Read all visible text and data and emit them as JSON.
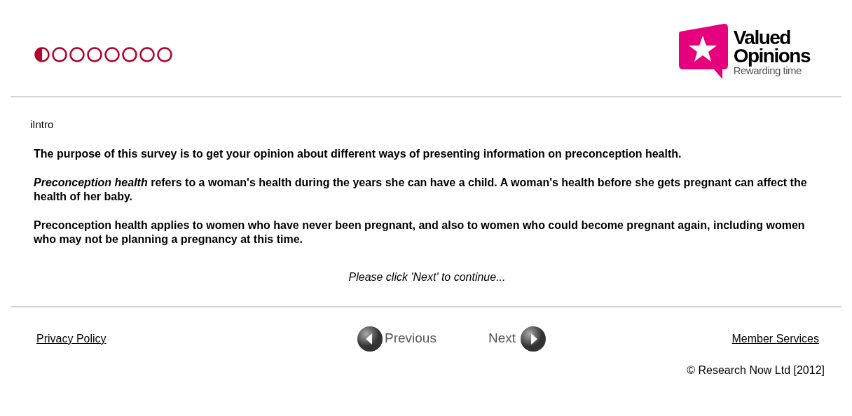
{
  "progress": [
    {
      "current": true
    },
    {
      "current": false
    },
    {
      "current": false
    },
    {
      "current": false
    },
    {
      "current": false
    },
    {
      "current": false
    },
    {
      "current": false
    },
    {
      "current": false
    }
  ],
  "logo": {
    "title_line_1": "Valued",
    "title_line_2": "Opinions",
    "tagline": "Rewarding time"
  },
  "question_id": "iIntro",
  "paragraphs": [
    "The purpose of this survey is to get your opinion about different ways of presenting information on preconception health.",
    "*Preconception health* refers to a woman's health during the years she can have a child. A woman's health before she gets pregnant can affect the health of her baby.",
    "Preconception health applies to women who have never been pregnant, and also to women who could become pregnant again, including women who may not be planning a pregnancy at this time."
  ],
  "instruction": "Please click 'Next' to continue...",
  "footer": {
    "privacy_link": "Privacy Policy",
    "previous_button": "Previous",
    "next_button": "Next",
    "member_link": "Member Services",
    "copyright": "© Research Now Ltd [2012]"
  }
}
